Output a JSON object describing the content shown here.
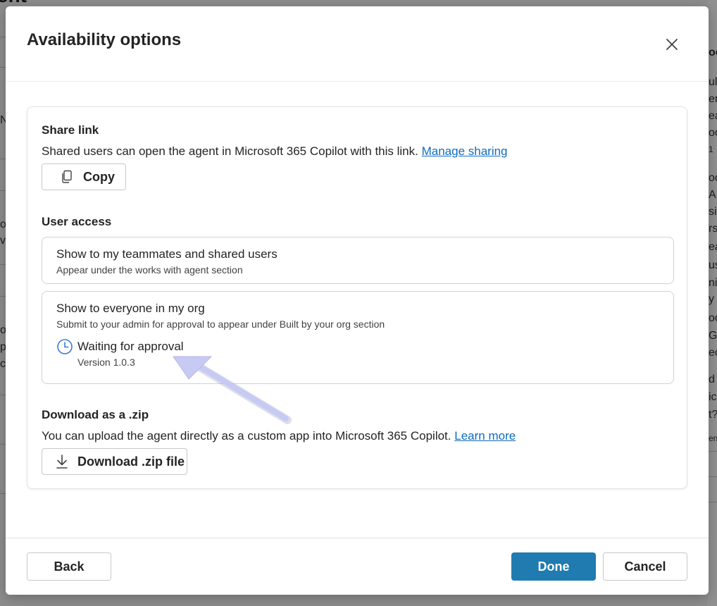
{
  "background": {
    "title_fragment": "ent",
    "left_fragments": [
      "N",
      "or",
      "vi",
      "o",
      "p",
      "cl"
    ],
    "right_fragments": [
      "oo",
      "ul",
      "en",
      "ea",
      "oo",
      "1",
      "oo",
      "A",
      "sin",
      "rs",
      "ea",
      "us",
      "nin",
      "y [",
      "oo",
      "G",
      "ec",
      "d",
      "ic",
      "t?",
      "en"
    ]
  },
  "dialog": {
    "title": "Availability options",
    "share_link": {
      "heading": "Share link",
      "description": "Shared users can open the agent in Microsoft 365 Copilot with this link.",
      "link_label": "Manage sharing",
      "copy_button": "Copy"
    },
    "user_access": {
      "heading": "User access",
      "options": [
        {
          "title": "Show to my teammates and shared users",
          "subtitle": "Appear under the works with agent section"
        },
        {
          "title": "Show to everyone in my org",
          "subtitle": "Submit to your admin for approval to appear under Built by your org section",
          "status": "Waiting for approval",
          "version": "Version 1.0.3"
        }
      ]
    },
    "download": {
      "heading": "Download as a .zip",
      "description": "You can upload the agent directly as a custom app into Microsoft 365 Copilot.",
      "link_label": "Learn more",
      "button": "Download .zip file"
    },
    "footer": {
      "back": "Back",
      "done": "Done",
      "cancel": "Cancel"
    }
  },
  "icons": {
    "close": "close-icon",
    "copy": "copy-icon",
    "clock": "clock-icon",
    "download": "download-icon"
  },
  "colors": {
    "primary": "#1f7bb0",
    "link": "#0f6cbd",
    "clock": "#3a7bd5",
    "annotation_arrow": "#c7caf2"
  }
}
